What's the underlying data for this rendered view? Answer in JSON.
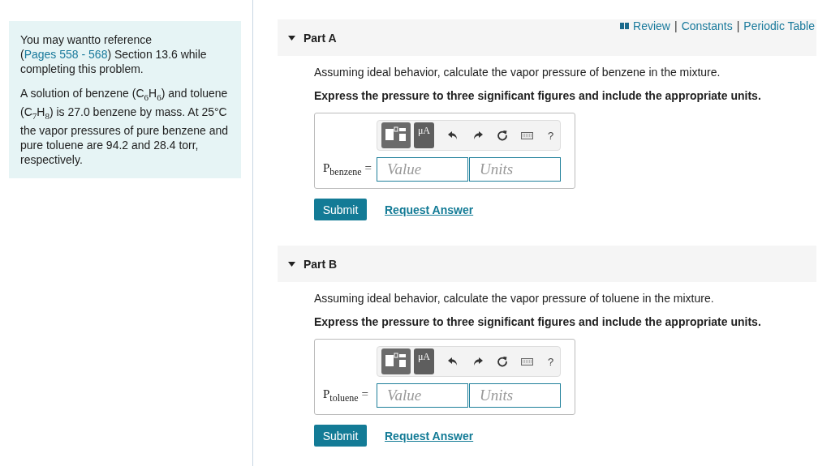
{
  "sidebar": {
    "reference": {
      "before": "You may wantto reference (",
      "link": "Pages 558 - 568",
      "after": ") Section 13.6 while completing this problem."
    },
    "problem": "A solution of benzene (C$_{6}$H$_{6}$) and toluene (C$_{7}$H$_{8}$) is 27.0 benzene by mass. At 25°C the vapor pressures of pure benzene and pure toluene are 94.2 and 28.4 torr, respectively."
  },
  "links": [
    "Review",
    "Constants",
    "Periodic Table"
  ],
  "link_separator": "|",
  "parts": [
    {
      "title": "Part A",
      "expanded": true,
      "question": "Assuming ideal behavior, calculate the vapor pressure of benzene in the mixture.",
      "instruction": "Express the pressure to three significant figures and include the appropriate units.",
      "units_button": "μA",
      "help": "?",
      "variable": "P$_{benzene}$ =",
      "value_placeholder": "Value",
      "units_placeholder": "Units",
      "submit": "Submit",
      "request": "Request Answer"
    },
    {
      "title": "Part B",
      "expanded": true,
      "question": "Assuming ideal behavior, calculate the vapor pressure of toluene in the mixture.",
      "instruction": "Express the pressure to three significant figures and include the appropriate units.",
      "units_button": "μA",
      "help": "?",
      "variable": "P$_{toluene}$ =",
      "value_placeholder": "Value",
      "units_placeholder": "Units",
      "submit": "Submit",
      "request": "Request Answer"
    }
  ]
}
